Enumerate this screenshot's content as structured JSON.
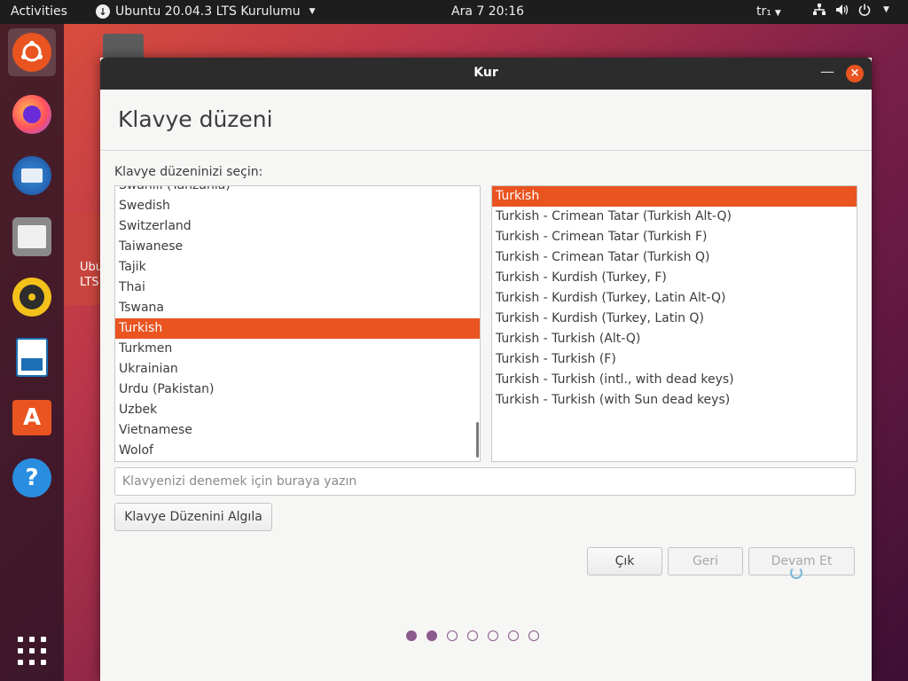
{
  "topbar": {
    "activities": "Activities",
    "app_menu": "Ubuntu 20.04.3 LTS Kurulumu",
    "clock": "Ara 7  20:16",
    "keyboard_indicator": "tr₁",
    "icons": [
      "network-icon",
      "volume-icon",
      "power-icon"
    ]
  },
  "dock": {
    "items": [
      "ubuntu-installer-icon",
      "firefox-icon",
      "thunderbird-icon",
      "files-icon",
      "rhythmbox-icon",
      "libreoffice-writer-icon",
      "software-center-icon",
      "help-icon"
    ],
    "apps_grid": "show-applications-icon"
  },
  "desktop": {
    "file_label_line1": "Ubu",
    "file_label_line2": "LTS"
  },
  "window": {
    "title": "Kur",
    "heading": "Klavye düzeni",
    "prompt": "Klavye düzeninizi seçin:",
    "layouts": [
      "Swahili (Tanzania)",
      "Swedish",
      "Switzerland",
      "Taiwanese",
      "Tajik",
      "Thai",
      "Tswana",
      "Turkish",
      "Turkmen",
      "Ukrainian",
      "Urdu (Pakistan)",
      "Uzbek",
      "Vietnamese",
      "Wolof"
    ],
    "selected_layout": "Turkish",
    "variants": [
      "Turkish",
      "Turkish - Crimean Tatar (Turkish Alt-Q)",
      "Turkish - Crimean Tatar (Turkish F)",
      "Turkish - Crimean Tatar (Turkish Q)",
      "Turkish - Kurdish (Turkey, F)",
      "Turkish - Kurdish (Turkey, Latin Alt-Q)",
      "Turkish - Kurdish (Turkey, Latin Q)",
      "Turkish - Turkish (Alt-Q)",
      "Turkish - Turkish (F)",
      "Turkish - Turkish (intl., with dead keys)",
      "Turkish - Turkish (with Sun dead keys)"
    ],
    "selected_variant": "Turkish",
    "test_placeholder": "Klavyenizi denemek için buraya yazın",
    "detect_button": "Klavye Düzenini Algıla",
    "quit_button": "Çık",
    "back_button": "Geri",
    "next_button": "Devam Et",
    "progress": {
      "total_steps": 7,
      "completed_steps": 2
    }
  },
  "colors": {
    "accent": "#e95420",
    "titlebar": "#2c2c2c",
    "topbar": "#1d1d1d",
    "progress_dot": "#8c5a8c"
  }
}
